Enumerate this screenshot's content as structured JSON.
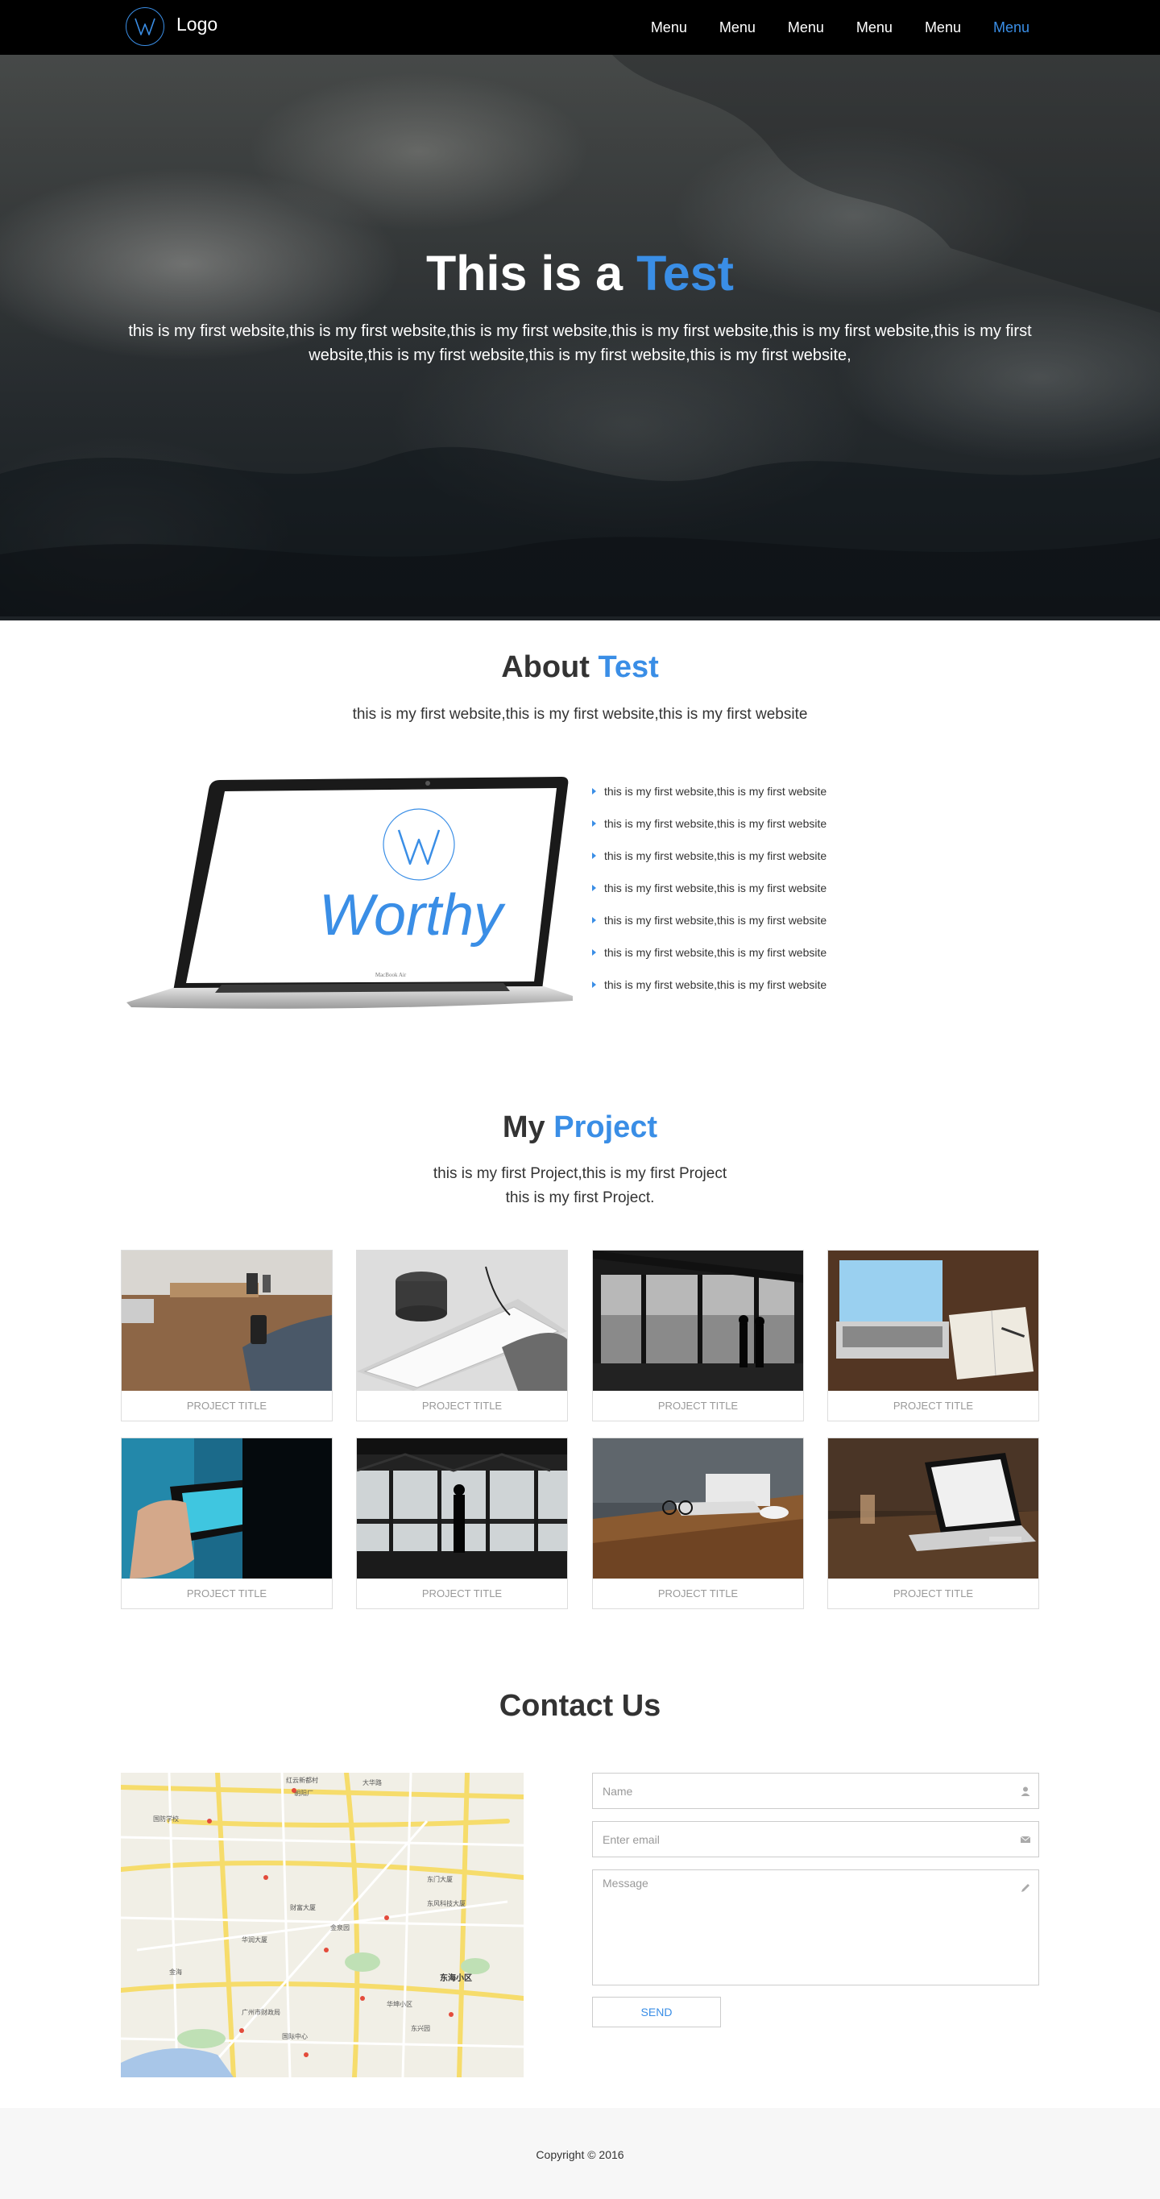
{
  "nav": {
    "logo_text": "Logo",
    "logo_letter": "W",
    "items": [
      {
        "label": "Menu"
      },
      {
        "label": "Menu"
      },
      {
        "label": "Menu"
      },
      {
        "label": "Menu"
      },
      {
        "label": "Menu"
      },
      {
        "label": "Menu",
        "active": true
      }
    ]
  },
  "hero": {
    "title_main": "This is a",
    "title_accent": "Test",
    "subtitle": "this is my first website,this is my first website,this is my first website,this is my first website,this is my first website,this is my first website,this is my first website,this is my first website,this is my first website,"
  },
  "about": {
    "title_main": "About",
    "title_accent": "Test",
    "subtitle": "this is my first website,this is my first website,this is my first website",
    "laptop_brand": "Worthy",
    "laptop_label": "MacBook Air",
    "features": [
      "this is my first website,this is my first website",
      "this is my first website,this is my first website",
      "this is my first website,this is my first website",
      "this is my first website,this is my first website",
      "this is my first website,this is my first website",
      "this is my first website,this is my first website",
      "this is my first website,this is my first website"
    ]
  },
  "projects": {
    "title_main": "My",
    "title_accent": "Project",
    "subtitle_line1": "this is my first Project,this is my first Project",
    "subtitle_line2": "this is my first Project.",
    "items": [
      {
        "caption": "PROJECT TITLE",
        "photo": "desk-phone"
      },
      {
        "caption": "PROJECT TITLE",
        "photo": "keyboard-mug"
      },
      {
        "caption": "PROJECT TITLE",
        "photo": "city-window"
      },
      {
        "caption": "PROJECT TITLE",
        "photo": "laptop-notebook"
      },
      {
        "caption": "PROJECT TITLE",
        "photo": "phone-hand"
      },
      {
        "caption": "PROJECT TITLE",
        "photo": "silhouette-window"
      },
      {
        "caption": "PROJECT TITLE",
        "photo": "glasses-desk"
      },
      {
        "caption": "PROJECT TITLE",
        "photo": "laptop-table"
      }
    ]
  },
  "contact": {
    "title": "Contact Us",
    "name_placeholder": "Name",
    "email_placeholder": "Enter email",
    "message_placeholder": "Message",
    "send_label": "SEND",
    "map_label": "东海小区",
    "map_place_labels": [
      "红云新都村",
      "朝阳厂",
      "大华路",
      "国防学校",
      "财富大厦",
      "东风科技大厦",
      "金泉园",
      "华润大厦",
      "东门大厦",
      "广州市财政局",
      "金海",
      "华坤小区",
      "国际中心",
      "东兴园"
    ]
  },
  "footer": {
    "copyright": "Copyright © 2016"
  },
  "colors": {
    "accent": "#3a8ee6",
    "nav_bg": "#000000",
    "footer_bg": "#f7f7f7"
  }
}
